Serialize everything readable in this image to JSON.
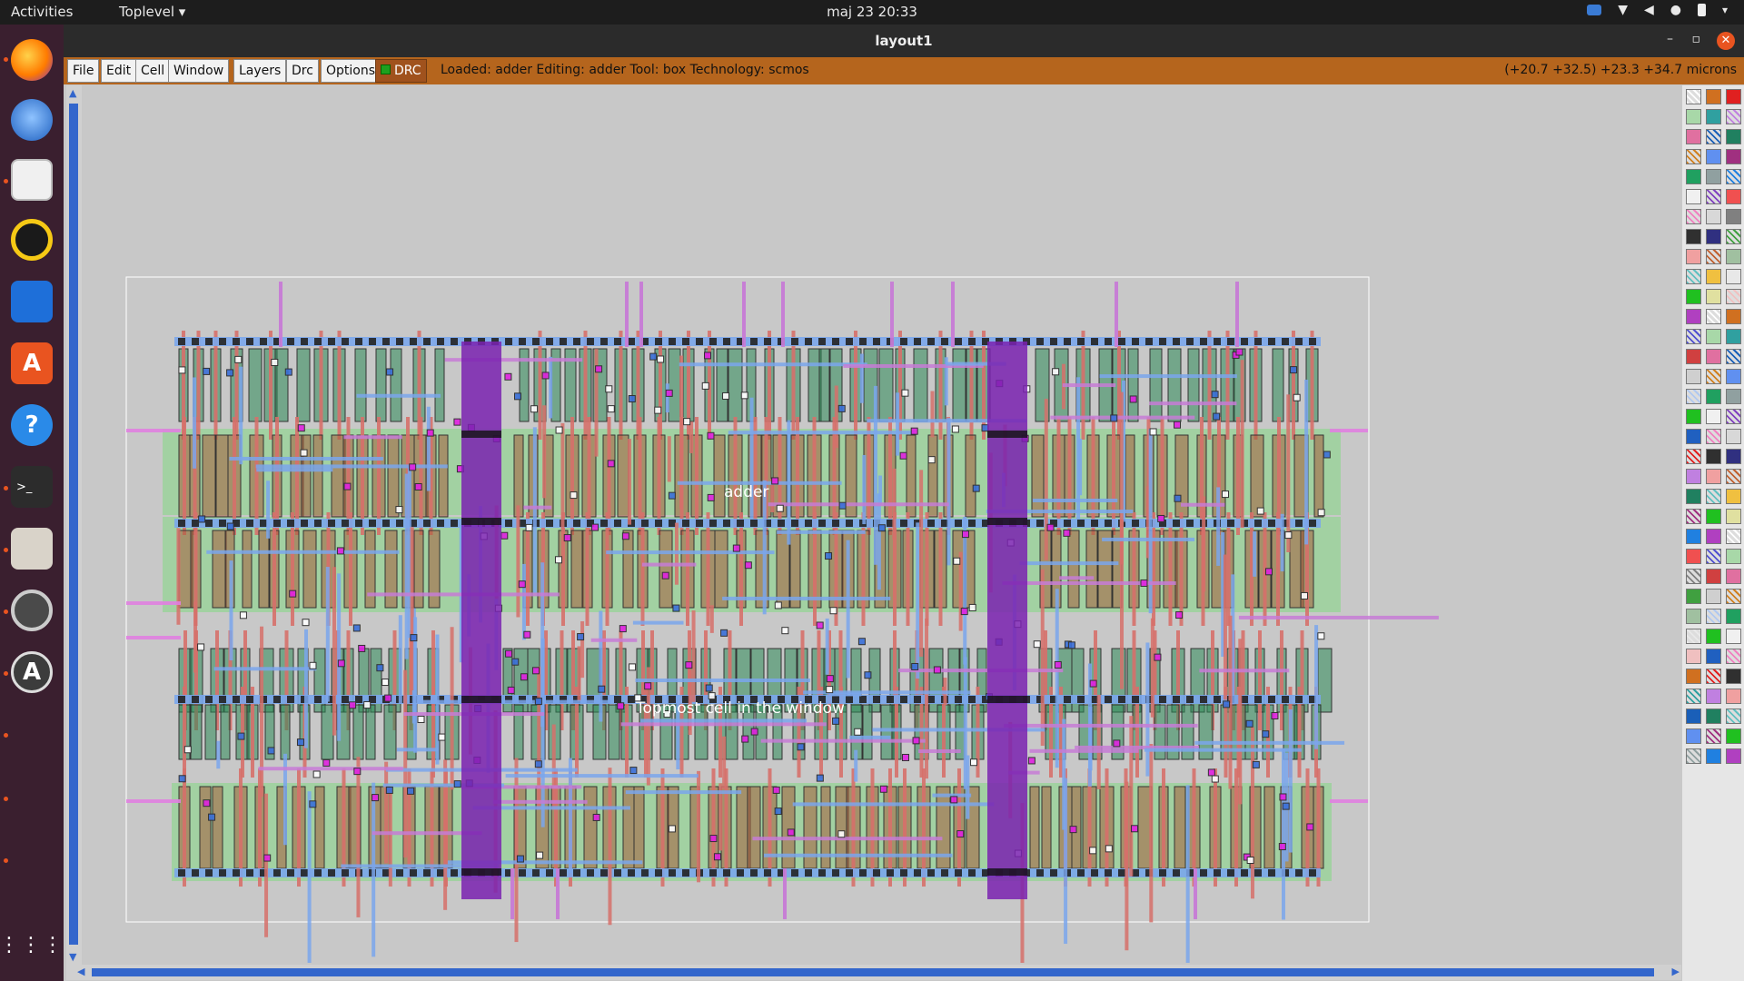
{
  "topbar": {
    "activities": "Activities",
    "app_menu": "Toplevel ▾",
    "clock": "maj 23  20:33"
  },
  "window": {
    "title": "layout1",
    "minimize": "–",
    "maximize": "▫",
    "close": "✕"
  },
  "menu": {
    "items": [
      "File",
      "Edit",
      "Cell",
      "Window",
      "Layers",
      "Drc",
      "Options"
    ],
    "drc_label": "DRC",
    "status": "Loaded: adder Editing: adder Tool: box  Technology: scmos",
    "coords": "(+20.7 +32.5) +23.3 +34.7 microns"
  },
  "layout": {
    "cell_label": "adder",
    "window_label": "Topmost cell in the window"
  },
  "colors": {
    "metal1": "#7aa6ec",
    "metal2": "#c77bd6",
    "poly": "#d6706a",
    "ndiff": "#2e8b57",
    "pdiff": "#a55c3c",
    "well": "#98d398",
    "via": "#7a22b0",
    "accent": "#b5651d"
  }
}
